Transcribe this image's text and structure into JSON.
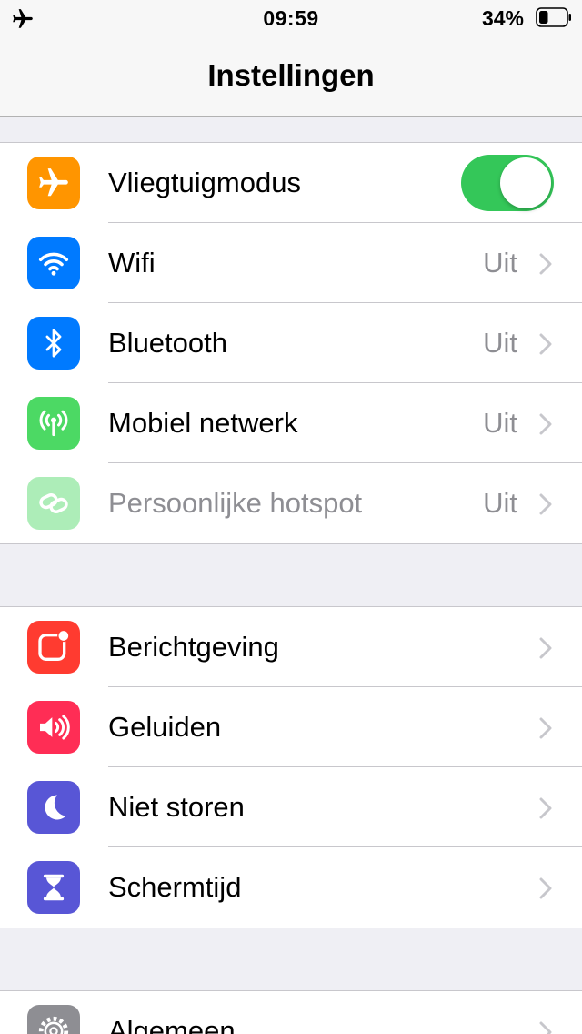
{
  "status_bar": {
    "time": "09:59",
    "battery_percent": "34%",
    "battery_level": 0.34,
    "airplane_icon": "airplane-icon"
  },
  "nav": {
    "title": "Instellingen"
  },
  "colors": {
    "orange": "#ff9500",
    "blue": "#007aff",
    "green": "#4cd964",
    "red": "#ff3b30",
    "pink": "#ff2d55",
    "purple": "#5856d6",
    "gray": "#8e8e93",
    "toggle_on": "#34c759"
  },
  "groups": [
    {
      "items": [
        {
          "label": "Vliegtuigmodus",
          "icon": "airplane-icon",
          "toggle_on": true
        },
        {
          "label": "Wifi",
          "value": "Uit",
          "icon": "wifi-icon"
        },
        {
          "label": "Bluetooth",
          "value": "Uit",
          "icon": "bluetooth-icon"
        },
        {
          "label": "Mobiel netwerk",
          "value": "Uit",
          "icon": "antenna-icon"
        },
        {
          "label": "Persoonlijke hotspot",
          "value": "Uit",
          "icon": "hotspot-icon",
          "disabled": true
        }
      ]
    },
    {
      "items": [
        {
          "label": "Berichtgeving",
          "icon": "notifications-icon"
        },
        {
          "label": "Geluiden",
          "icon": "speaker-icon"
        },
        {
          "label": "Niet storen",
          "icon": "moon-icon"
        },
        {
          "label": "Schermtijd",
          "icon": "hourglass-icon"
        }
      ]
    },
    {
      "items": [
        {
          "label": "Algemeen",
          "icon": "gear-icon"
        }
      ]
    }
  ]
}
